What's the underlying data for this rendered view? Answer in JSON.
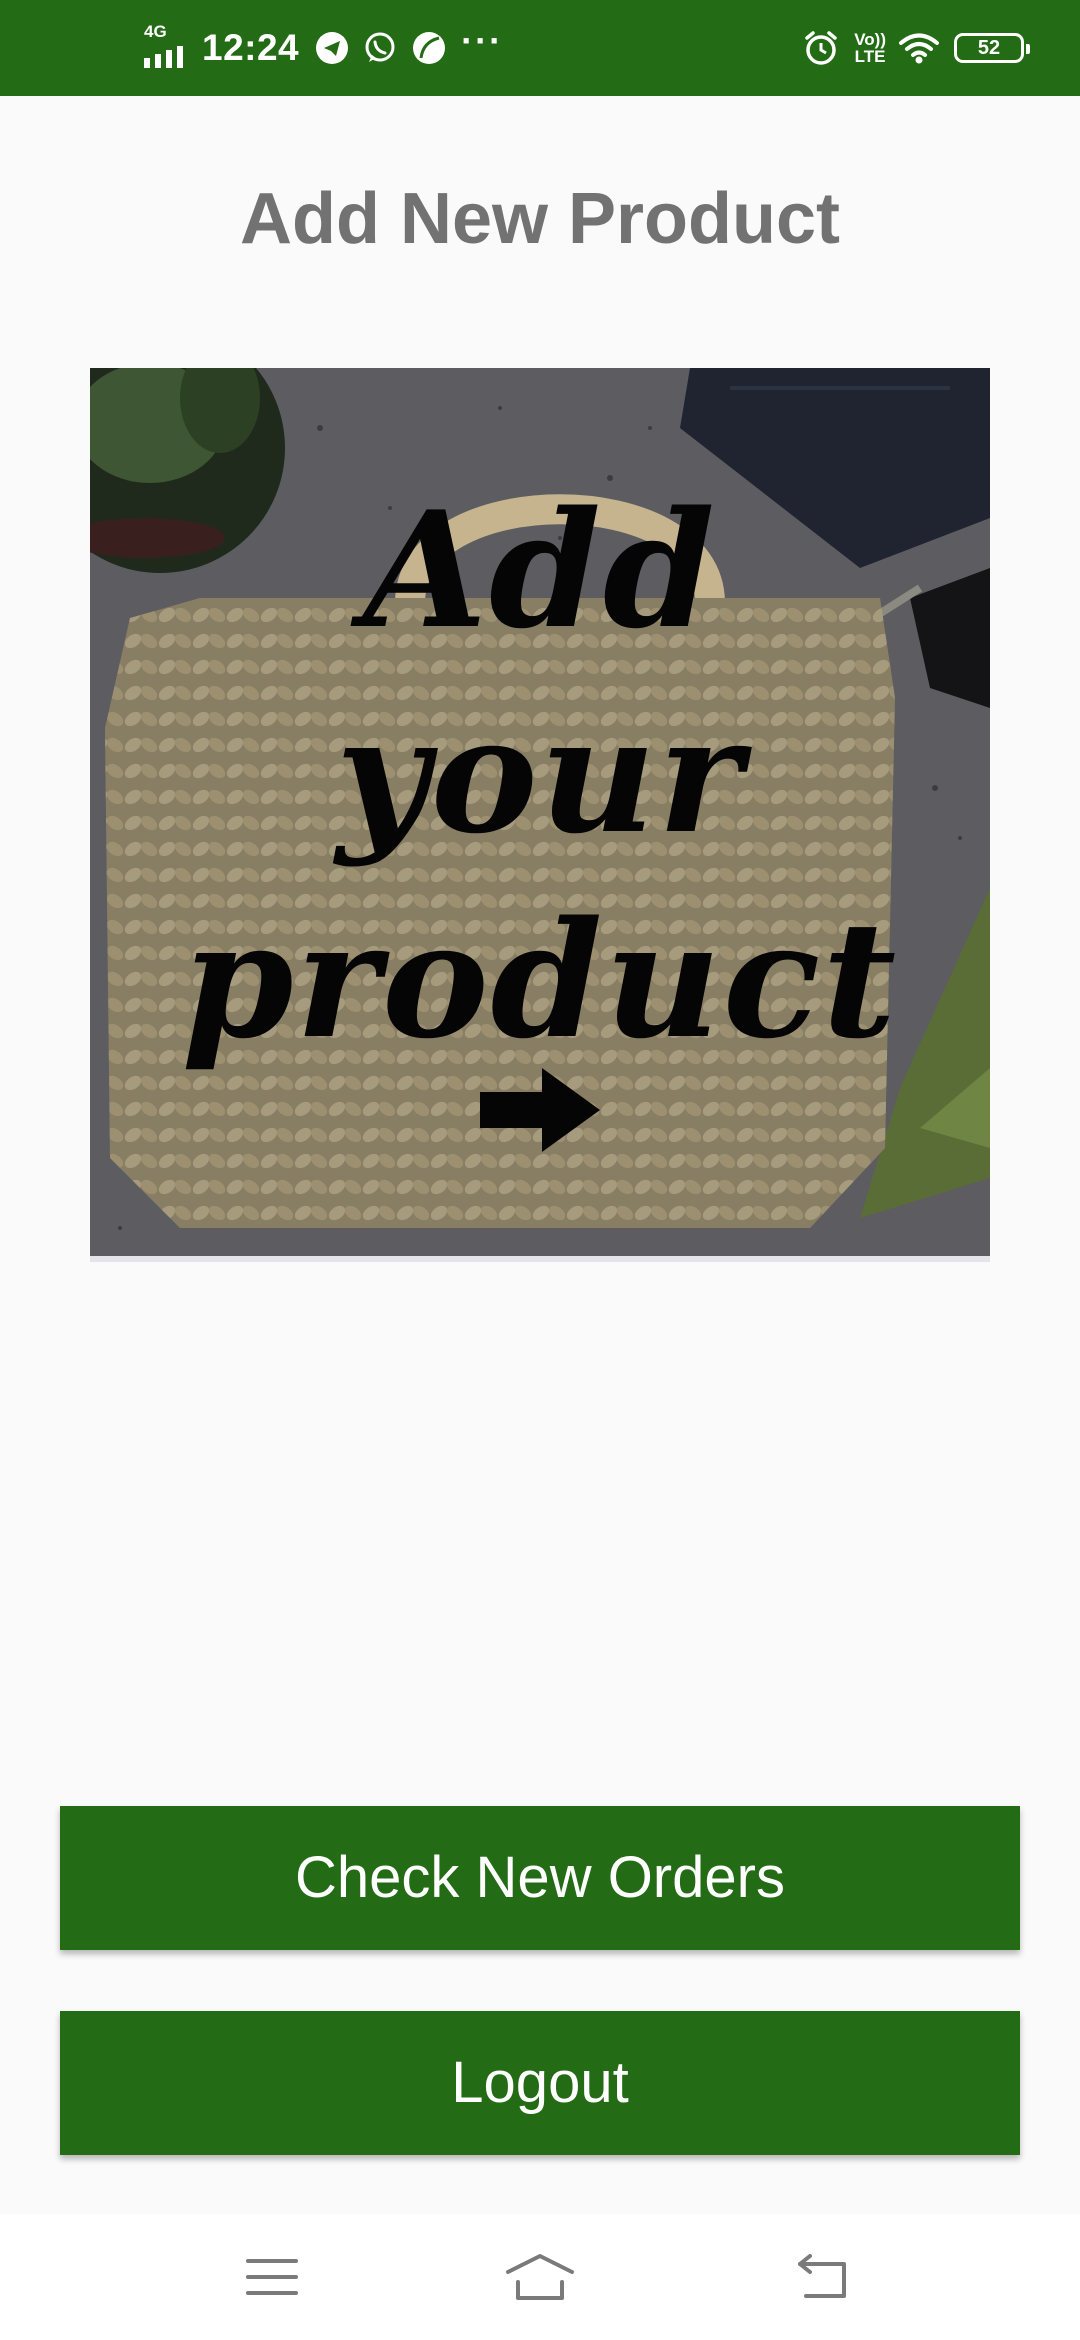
{
  "status_bar": {
    "network": "4G",
    "time": "12:24",
    "volte_top": "Vo))",
    "volte_bottom": "LTE",
    "battery": "52",
    "icons": [
      "signal-icon",
      "telegram-icon",
      "whatsapp-icon",
      "leaf-icon",
      "more-icon",
      "alarm-icon",
      "volte-icon",
      "wifi-icon",
      "battery-icon"
    ]
  },
  "page": {
    "title": "Add New Product"
  },
  "banner": {
    "line1": "Add",
    "line2": "your",
    "line3": "product",
    "icon": "right-arrow-icon"
  },
  "buttons": {
    "check_orders": "Check New Orders",
    "logout": "Logout"
  },
  "nav": {
    "icons": [
      "menu-icon",
      "home-icon",
      "back-icon"
    ]
  },
  "colors": {
    "primary": "#236b15",
    "background": "#fafafa",
    "title": "#727272"
  }
}
